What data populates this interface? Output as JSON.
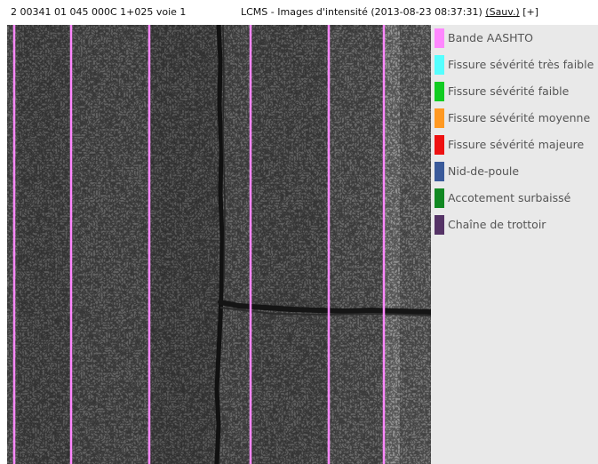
{
  "header": {
    "route": "2 00341 01 045 000C 1+025 voie 1",
    "title": "LCMS - Images d'intensité (2013-08-23 08:37:31)",
    "save_link": "(Sauv.)",
    "expand": "[+]"
  },
  "legend": {
    "items": [
      {
        "label": "Bande AASHTO",
        "color": "#ff88ff"
      },
      {
        "label": "Fissure sévérité très faible",
        "color": "#55ffff"
      },
      {
        "label": "Fissure sévérité faible",
        "color": "#11cc22"
      },
      {
        "label": "Fissure sévérité moyenne",
        "color": "#ff9922"
      },
      {
        "label": "Fissure sévérité majeure",
        "color": "#ee1111"
      },
      {
        "label": "Nid-de-poule",
        "color": "#3a5a9a"
      },
      {
        "label": "Accotement surbaissé",
        "color": "#118822"
      },
      {
        "label": "Chaîne de trottoir",
        "color": "#553366"
      }
    ]
  }
}
